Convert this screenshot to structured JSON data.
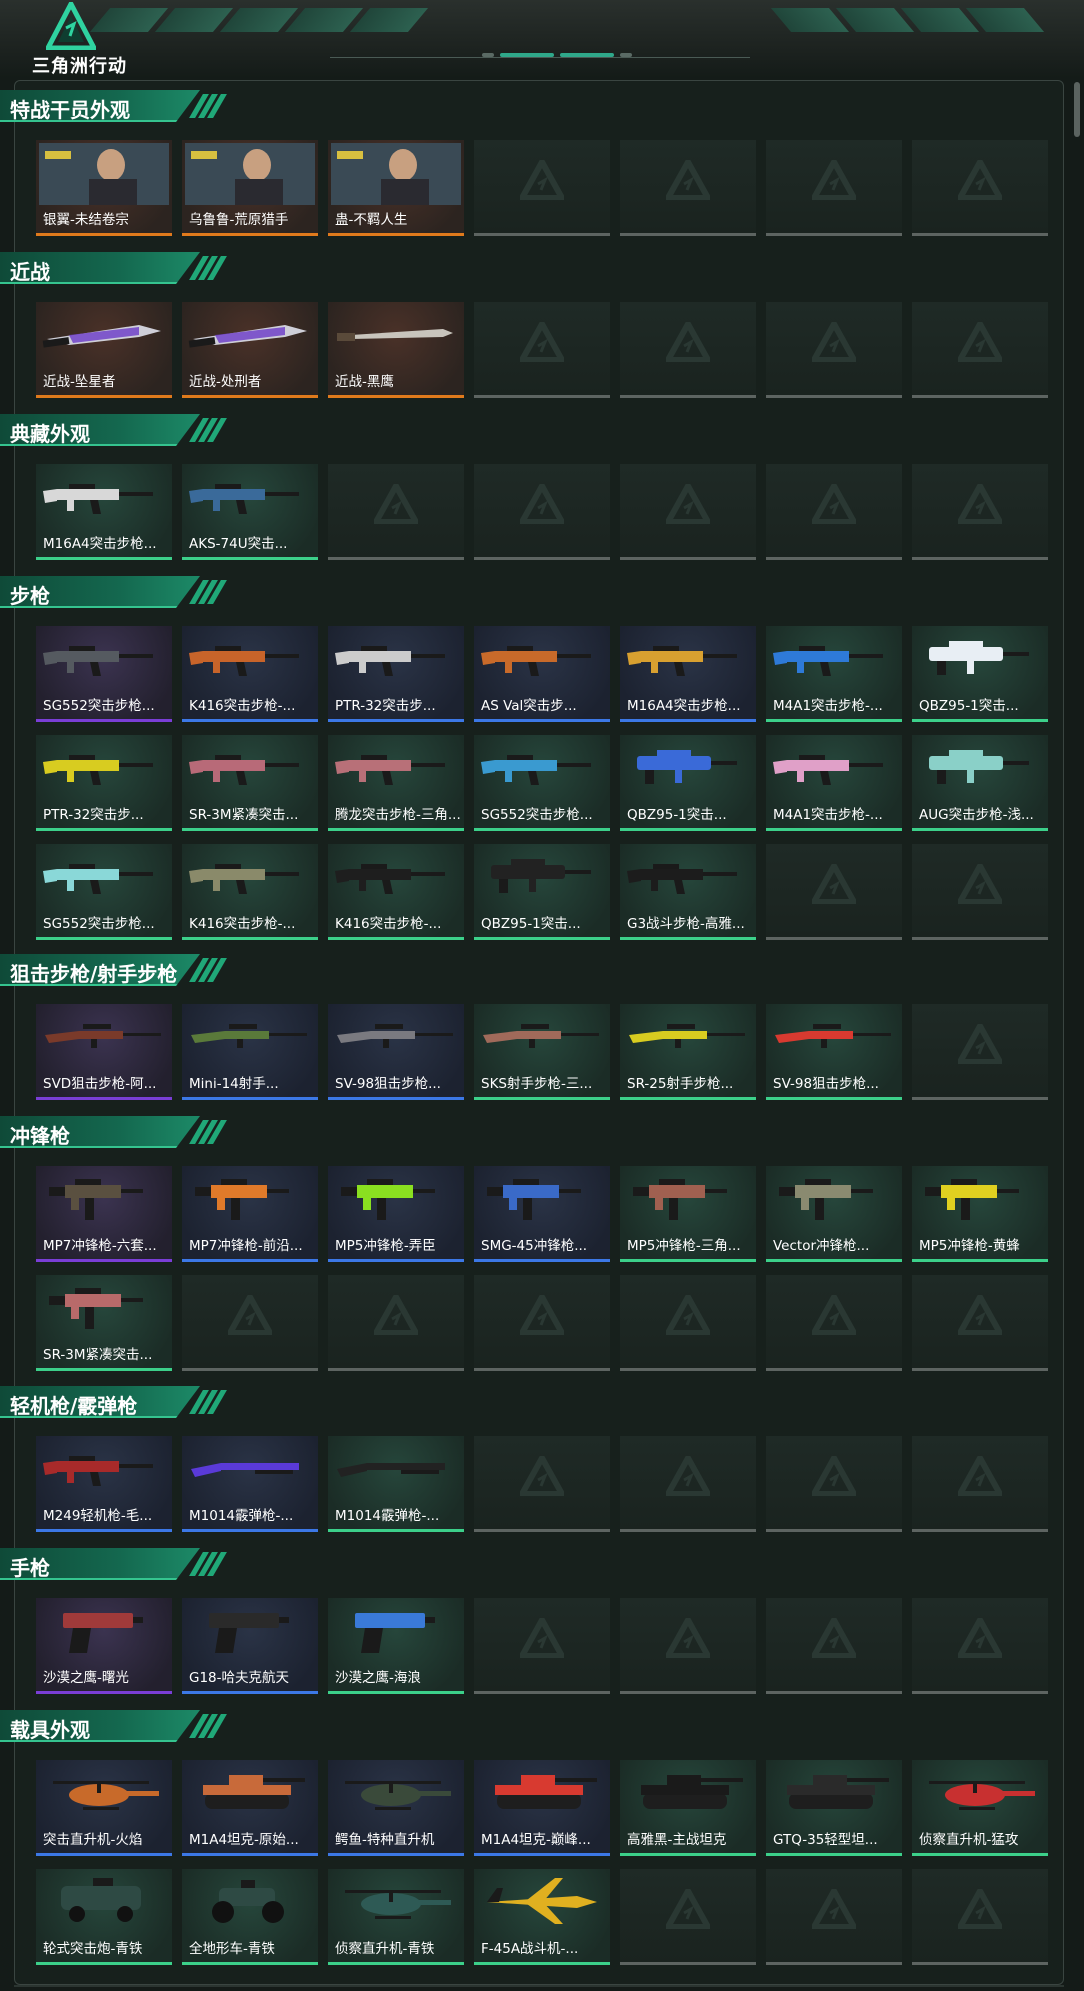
{
  "header": {
    "logo_text": "三角洲行动"
  },
  "sections": [
    {
      "title": "特战干员外观",
      "rows": [
        [
          {
            "label": "银翼-未结卷宗",
            "rarity": "orange",
            "kind": "agent"
          },
          {
            "label": "乌鲁鲁-荒原猎手",
            "rarity": "orange",
            "kind": "agent"
          },
          {
            "label": "蛊-不羁人生",
            "rarity": "orange",
            "kind": "agent"
          },
          null,
          null,
          null,
          null
        ]
      ]
    },
    {
      "title": "近战",
      "rows": [
        [
          {
            "label": "近战-坠星者",
            "rarity": "orange",
            "kind": "blade"
          },
          {
            "label": "近战-处刑者",
            "rarity": "orange",
            "kind": "blade"
          },
          {
            "label": "近战-黑鹰",
            "rarity": "orange",
            "kind": "knife"
          },
          null,
          null,
          null,
          null
        ]
      ]
    },
    {
      "title": "典藏外观",
      "rows": [
        [
          {
            "label": "M16A4突击步枪...",
            "rarity": "green",
            "kind": "rifle",
            "color": "#d8d8d8"
          },
          {
            "label": "AKS-74U突击...",
            "rarity": "green",
            "kind": "rifle",
            "color": "#3a6a9a"
          },
          null,
          null,
          null,
          null,
          null
        ]
      ]
    },
    {
      "title": "步枪",
      "rows": [
        [
          {
            "label": "SG552突击步枪...",
            "rarity": "purple",
            "kind": "rifle",
            "color": "#555a60"
          },
          {
            "label": "K416突击步枪-...",
            "rarity": "blue",
            "kind": "rifle",
            "color": "#c8642a"
          },
          {
            "label": "PTR-32突击步...",
            "rarity": "blue",
            "kind": "rifle",
            "color": "#cccccc"
          },
          {
            "label": "AS Val突击步...",
            "rarity": "blue",
            "kind": "rifle",
            "color": "#c86a2a"
          },
          {
            "label": "M16A4突击步枪...",
            "rarity": "blue",
            "kind": "rifle",
            "color": "#d8a030"
          },
          {
            "label": "M4A1突击步枪-...",
            "rarity": "green",
            "kind": "rifle",
            "color": "#2e7ad8"
          },
          {
            "label": "QBZ95-1突击...",
            "rarity": "green",
            "kind": "bullpup",
            "color": "#e8eef4"
          }
        ],
        [
          {
            "label": "PTR-32突击步...",
            "rarity": "green",
            "kind": "rifle",
            "color": "#d8cc20"
          },
          {
            "label": "SR-3M紧凑突击...",
            "rarity": "green",
            "kind": "rifle",
            "color": "#b86a78"
          },
          {
            "label": "腾龙突击步枪-三角...",
            "rarity": "green",
            "kind": "rifle",
            "color": "#b87078"
          },
          {
            "label": "SG552突击步枪...",
            "rarity": "green",
            "kind": "rifle",
            "color": "#3a9ad0"
          },
          {
            "label": "QBZ95-1突击...",
            "rarity": "green",
            "kind": "bullpup",
            "color": "#3a6ad8"
          },
          {
            "label": "M4A1突击步枪-...",
            "rarity": "green",
            "kind": "rifle",
            "color": "#e0a0c8"
          },
          {
            "label": "AUG突击步枪-浅...",
            "rarity": "green",
            "kind": "bullpup",
            "color": "#8ad0c8"
          }
        ],
        [
          {
            "label": "SG552突击步枪...",
            "rarity": "green",
            "kind": "rifle",
            "color": "#8ad8d8"
          },
          {
            "label": "K416突击步枪-...",
            "rarity": "green",
            "kind": "rifle",
            "color": "#8a8a6a"
          },
          {
            "label": "K416突击步枪-...",
            "rarity": "green",
            "kind": "rifle",
            "color": "#1e1e1e"
          },
          {
            "label": "QBZ95-1突击...",
            "rarity": "green",
            "kind": "bullpup",
            "color": "#222222"
          },
          {
            "label": "G3战斗步枪-高雅...",
            "rarity": "green",
            "kind": "rifle",
            "color": "#1c1c1c"
          },
          null,
          null
        ]
      ]
    },
    {
      "title": "狙击步枪/射手步枪",
      "rows": [
        [
          {
            "label": "SVD狙击步枪-阿...",
            "rarity": "purple",
            "kind": "sniper",
            "color": "#7a3a2a"
          },
          {
            "label": "Mini-14射手...",
            "rarity": "blue",
            "kind": "sniper",
            "color": "#5a7a3a"
          },
          {
            "label": "SV-98狙击步枪...",
            "rarity": "blue",
            "kind": "sniper",
            "color": "#7a7a80"
          },
          {
            "label": "SKS射手步枪-三...",
            "rarity": "green",
            "kind": "sniper",
            "color": "#a06a5a"
          },
          {
            "label": "SR-25射手步枪...",
            "rarity": "green",
            "kind": "sniper",
            "color": "#d8cc20"
          },
          {
            "label": "SV-98狙击步枪...",
            "rarity": "green",
            "kind": "sniper",
            "color": "#d83a30"
          },
          null
        ]
      ]
    },
    {
      "title": "冲锋枪",
      "rows": [
        [
          {
            "label": "MP7冲锋枪-六套...",
            "rarity": "purple",
            "kind": "smg",
            "color": "#5a5040"
          },
          {
            "label": "MP7冲锋枪-前沿...",
            "rarity": "blue",
            "kind": "smg",
            "color": "#e07a2a"
          },
          {
            "label": "MP5冲锋枪-弄臣",
            "rarity": "blue",
            "kind": "smg",
            "color": "#8ae020"
          },
          {
            "label": "SMG-45冲锋枪...",
            "rarity": "blue",
            "kind": "smg",
            "color": "#3a6ac8"
          },
          {
            "label": "MP5冲锋枪-三角...",
            "rarity": "green",
            "kind": "smg",
            "color": "#a06050"
          },
          {
            "label": "Vector冲锋枪...",
            "rarity": "green",
            "kind": "smg",
            "color": "#8a8a70"
          },
          {
            "label": "MP5冲锋枪-黄蜂",
            "rarity": "green",
            "kind": "smg",
            "color": "#e0d020"
          }
        ],
        [
          {
            "label": "SR-3M紧凑突击...",
            "rarity": "green",
            "kind": "smg",
            "color": "#b86a6a"
          },
          null,
          null,
          null,
          null,
          null,
          null
        ]
      ]
    },
    {
      "title": "轻机枪/霰弹枪",
      "rows": [
        [
          {
            "label": "M249轻机枪-毛...",
            "rarity": "blue",
            "kind": "lmg",
            "color": "#a82a2a"
          },
          {
            "label": "M1014霰弹枪-...",
            "rarity": "blue",
            "kind": "shotgun",
            "color": "#5a3ad8"
          },
          {
            "label": "M1014霰弹枪-...",
            "rarity": "green",
            "kind": "shotgun",
            "color": "#222222"
          },
          null,
          null,
          null,
          null
        ]
      ]
    },
    {
      "title": "手枪",
      "rows": [
        [
          {
            "label": "沙漠之鹰-曙光",
            "rarity": "purple",
            "kind": "pistol",
            "color": "#a03a3a"
          },
          {
            "label": "G18-哈夫克航天",
            "rarity": "blue",
            "kind": "pistol",
            "color": "#2a2a2a"
          },
          {
            "label": "沙漠之鹰-海浪",
            "rarity": "green",
            "kind": "pistol",
            "color": "#3a7ad8"
          },
          null,
          null,
          null,
          null
        ]
      ]
    },
    {
      "title": "载具外观",
      "rows": [
        [
          {
            "label": "突击直升机-火焰",
            "rarity": "blue",
            "kind": "heli",
            "color": "#c86a2a"
          },
          {
            "label": "M1A4坦克-原始...",
            "rarity": "blue",
            "kind": "tank",
            "color": "#c86a3a"
          },
          {
            "label": "鳄鱼-特种直升机",
            "rarity": "blue",
            "kind": "heli",
            "color": "#3a4a3a"
          },
          {
            "label": "M1A4坦克-巅峰...",
            "rarity": "blue",
            "kind": "tank",
            "color": "#d83a30"
          },
          {
            "label": "高雅黑-主战坦克",
            "rarity": "green",
            "kind": "tank",
            "color": "#1a1a1a"
          },
          {
            "label": "GTQ-35轻型坦...",
            "rarity": "green",
            "kind": "tank",
            "color": "#2a2a2a"
          },
          {
            "label": "侦察直升机-猛攻",
            "rarity": "green",
            "kind": "heli",
            "color": "#c83030"
          }
        ],
        [
          {
            "label": "轮式突击炮-青铁",
            "rarity": "green",
            "kind": "car",
            "color": "#2e4a44"
          },
          {
            "label": "全地形车-青铁",
            "rarity": "green",
            "kind": "atv",
            "color": "#2e4a44"
          },
          {
            "label": "侦察直升机-青铁",
            "rarity": "green",
            "kind": "heli",
            "color": "#2e5a55"
          },
          {
            "label": "F-45A战斗机-...",
            "rarity": "green",
            "kind": "jet",
            "color": "#e0b020"
          },
          null,
          null,
          null
        ]
      ]
    }
  ]
}
